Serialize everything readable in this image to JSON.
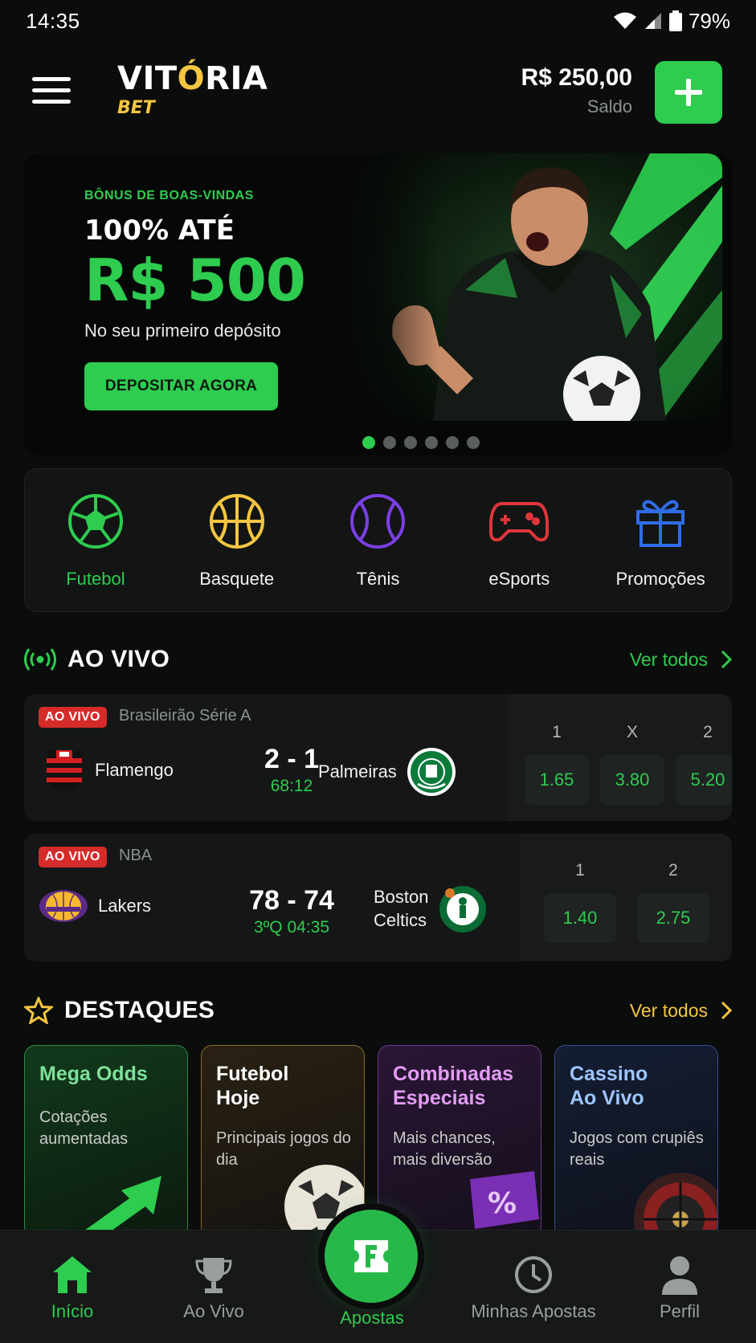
{
  "status": {
    "time": "14:35",
    "battery": "79%"
  },
  "header": {
    "logo_main_a": "VIT",
    "logo_main_o": "Ó",
    "logo_main_b": "RIA",
    "logo_sub": "BET",
    "balance_amount": "R$ 250,00",
    "balance_label": "Saldo"
  },
  "banner": {
    "eyebrow": "BÔNUS DE BOAS-VINDAS",
    "line1": "100% ATÉ",
    "big": "R$ 500",
    "desc": "No seu primeiro depósito",
    "cta": "DEPOSITAR AGORA",
    "slides": 6,
    "active_slide": 1
  },
  "sports": [
    {
      "label": "Futebol",
      "icon": "soccer-ball-icon",
      "color": "#2ecc4f",
      "active": true
    },
    {
      "label": "Basquete",
      "icon": "basketball-icon",
      "color": "#f5c542",
      "active": false
    },
    {
      "label": "Tênis",
      "icon": "tennis-ball-icon",
      "color": "#7b3fe4",
      "active": false
    },
    {
      "label": "eSports",
      "icon": "gamepad-icon",
      "color": "#e0353a",
      "active": false
    },
    {
      "label": "Promoções",
      "icon": "gift-icon",
      "color": "#2f6de8",
      "active": false
    }
  ],
  "live": {
    "title": "AO VIVO",
    "see_all": "Ver todos",
    "matches": [
      {
        "badge": "AO VIVO",
        "league": "Brasileirão Série A",
        "home": "Flamengo",
        "away": "Palmeiras",
        "score": "2 - 1",
        "time": "68:12",
        "odds": [
          {
            "label": "1",
            "value": "1.65"
          },
          {
            "label": "X",
            "value": "3.80"
          },
          {
            "label": "2",
            "value": "5.20"
          }
        ]
      },
      {
        "badge": "AO VIVO",
        "league": "NBA",
        "home": "Lakers",
        "away_line1": "Boston",
        "away_line2": "Celtics",
        "score": "78 - 74",
        "time": "3ºQ 04:35",
        "odds": [
          {
            "label": "1",
            "value": "1.40"
          },
          {
            "label": "2",
            "value": "2.75"
          }
        ]
      }
    ]
  },
  "highlights": {
    "title": "DESTAQUES",
    "see_all": "Ver todos",
    "cards": [
      {
        "title": "Mega Odds",
        "subtitle": "Cotações aumentadas",
        "color": "#7ee09a"
      },
      {
        "title_l1": "Futebol",
        "title_l2": "Hoje",
        "subtitle": "Principais jogos do dia",
        "color": "#ffffff"
      },
      {
        "title_l1": "Combinadas",
        "title_l2": "Especiais",
        "subtitle": "Mais chances, mais diversão",
        "color": "#e39cf5"
      },
      {
        "title_l1": "Cassino",
        "title_l2": "Ao Vivo",
        "subtitle": "Jogos com crupiês reais",
        "color": "#9ec5ff"
      }
    ]
  },
  "nav": [
    {
      "label": "Início",
      "icon": "home-icon",
      "active": true
    },
    {
      "label": "Ao Vivo",
      "icon": "trophy-icon",
      "active": false
    },
    {
      "label": "Apostas",
      "icon": "ticket-icon",
      "active": false
    },
    {
      "label": "Minhas Apostas",
      "icon": "clock-icon",
      "active": false
    },
    {
      "label": "Perfil",
      "icon": "user-icon",
      "active": false
    }
  ]
}
